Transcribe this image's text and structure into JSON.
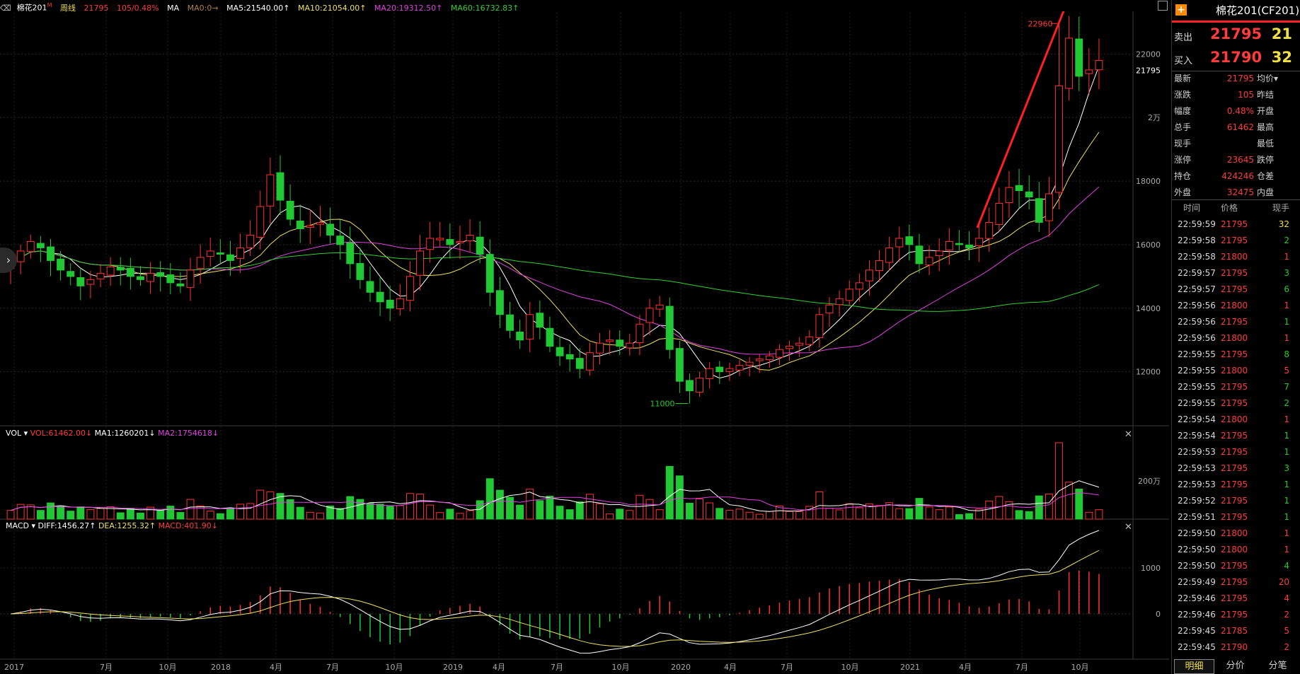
{
  "toolbar": {
    "symbol": "棉花201",
    "symbol_mark": "M",
    "period": "周线",
    "last": "21795",
    "change": "105/0.48%",
    "indicator": "MA",
    "ma0": "MA0:0→",
    "ma5": "MA5:21540.00↑",
    "ma10": "MA10:21054.00↑",
    "ma20": "MA20:19312.50↑",
    "ma60": "MA60:16732.83↑"
  },
  "vol_legend": {
    "name": "VOL",
    "vol": "VOL:61462.00↓",
    "ma1": "MA1:1260201↓",
    "ma2": "MA2:1754618↓"
  },
  "macd_legend": {
    "name": "MACD",
    "diff": "DIFF:1456.27↑",
    "dea": "DEA:1255.32↑",
    "macd": "MACD:401.90↓"
  },
  "colors": {
    "up": "#ff3232",
    "down": "#21c834",
    "ma5": "#ffffff",
    "ma10": "#f0e060",
    "ma20": "#e040e0",
    "ma60": "#30d030",
    "arrow": "#ff2020"
  },
  "chart_data": {
    "type": "candlestick",
    "x_ticks": [
      "2017",
      "7月",
      "10月",
      "2018",
      "4月",
      "7月",
      "10月",
      "2019",
      "4月",
      "7月",
      "10月",
      "2020",
      "4月",
      "7月",
      "10月",
      "2021",
      "4月",
      "7月",
      "10月"
    ],
    "y_ticks": [
      "22000",
      "2万",
      "18000",
      "16000",
      "14000",
      "12000"
    ],
    "y_range": [
      11000,
      22960
    ],
    "current_price_label": "21795",
    "high_label": "22960",
    "low_label": "11000",
    "vol_tick": "200万",
    "macd_ticks": [
      "1000",
      "0"
    ],
    "close_series": [
      15400,
      15800,
      16100,
      15900,
      15500,
      15200,
      15000,
      14700,
      14900,
      15100,
      15300,
      15200,
      15000,
      14900,
      15100,
      15000,
      14800,
      14700,
      15200,
      15600,
      15800,
      15700,
      15500,
      15900,
      16300,
      17200,
      18200,
      17400,
      16800,
      16500,
      16600,
      16700,
      16300,
      16000,
      15400,
      14900,
      14500,
      14200,
      14000,
      14300,
      15000,
      15800,
      16200,
      16200,
      16000,
      16100,
      16300,
      15700,
      14500,
      13800,
      13300,
      13000,
      13800,
      13400,
      12800,
      12500,
      12400,
      12100,
      12600,
      12900,
      13000,
      12800,
      12900,
      13500,
      14000,
      14100,
      12700,
      11700,
      11400,
      11800,
      12100,
      12000,
      12100,
      12200,
      12300,
      12400,
      12500,
      12700,
      12800,
      12900,
      13100,
      13800,
      14100,
      14300,
      14600,
      14800,
      15200,
      15500,
      15900,
      16200,
      16000,
      15400,
      15600,
      15800,
      16100,
      16000,
      15900,
      16200,
      16700,
      17300,
      17800,
      17700,
      17500,
      16700,
      17600,
      21000,
      22500,
      21300,
      21500,
      21795
    ]
  },
  "quote": {
    "title": "棉花201(CF201)",
    "sell_label": "卖出",
    "sell_price": "21795",
    "sell_qty": "21",
    "buy_label": "买入",
    "buy_price": "21790",
    "buy_qty": "32",
    "rows": [
      {
        "l": "最新",
        "v": "21795",
        "r": "均价▾"
      },
      {
        "l": "涨跌",
        "v": "105",
        "r": "昨结"
      },
      {
        "l": "幅度",
        "v": "0.48%",
        "r": "开盘"
      },
      {
        "l": "总手",
        "v": "61462",
        "r": "最高"
      },
      {
        "l": "现手",
        "v": "",
        "r": "最低"
      },
      {
        "l": "涨停",
        "v": "23645",
        "r": "跌停"
      },
      {
        "l": "持仓",
        "v": "424246",
        "r": "仓差"
      },
      {
        "l": "外盘",
        "v": "32475",
        "r": "内盘"
      }
    ]
  },
  "ticks_header": {
    "time": "时间",
    "price": "价格",
    "qty": "现手"
  },
  "ticks": [
    {
      "t": "22:59:59",
      "p": "21795",
      "q": "32",
      "qc": "yellow"
    },
    {
      "t": "22:59:58",
      "p": "21795",
      "q": "2",
      "qc": "green"
    },
    {
      "t": "22:59:58",
      "p": "21800",
      "q": "1",
      "qc": "red"
    },
    {
      "t": "22:59:57",
      "p": "21795",
      "q": "3",
      "qc": "green"
    },
    {
      "t": "22:59:57",
      "p": "21795",
      "q": "6",
      "qc": "green"
    },
    {
      "t": "22:59:56",
      "p": "21800",
      "q": "1",
      "qc": "red"
    },
    {
      "t": "22:59:56",
      "p": "21795",
      "q": "1",
      "qc": "green"
    },
    {
      "t": "22:59:56",
      "p": "21800",
      "q": "1",
      "qc": "red"
    },
    {
      "t": "22:59:55",
      "p": "21795",
      "q": "8",
      "qc": "green"
    },
    {
      "t": "22:59:55",
      "p": "21800",
      "q": "5",
      "qc": "red"
    },
    {
      "t": "22:59:55",
      "p": "21795",
      "q": "7",
      "qc": "green"
    },
    {
      "t": "22:59:55",
      "p": "21795",
      "q": "2",
      "qc": "green"
    },
    {
      "t": "22:59:54",
      "p": "21800",
      "q": "1",
      "qc": "red"
    },
    {
      "t": "22:59:54",
      "p": "21795",
      "q": "1",
      "qc": "green"
    },
    {
      "t": "22:59:53",
      "p": "21795",
      "q": "1",
      "qc": "green"
    },
    {
      "t": "22:59:53",
      "p": "21795",
      "q": "3",
      "qc": "green"
    },
    {
      "t": "22:59:53",
      "p": "21795",
      "q": "1",
      "qc": "green"
    },
    {
      "t": "22:59:52",
      "p": "21795",
      "q": "1",
      "qc": "green"
    },
    {
      "t": "22:59:51",
      "p": "21795",
      "q": "1",
      "qc": "green"
    },
    {
      "t": "22:59:50",
      "p": "21800",
      "q": "1",
      "qc": "red"
    },
    {
      "t": "22:59:50",
      "p": "21800",
      "q": "1",
      "qc": "red"
    },
    {
      "t": "22:59:50",
      "p": "21795",
      "q": "4",
      "qc": "green"
    },
    {
      "t": "22:59:49",
      "p": "21795",
      "q": "20",
      "qc": "red"
    },
    {
      "t": "22:59:46",
      "p": "21795",
      "q": "4",
      "qc": "red"
    },
    {
      "t": "22:59:46",
      "p": "21795",
      "q": "2",
      "qc": "red"
    },
    {
      "t": "22:59:45",
      "p": "21785",
      "q": "5",
      "qc": "red"
    },
    {
      "t": "22:59:45",
      "p": "21790",
      "q": "2",
      "qc": "red"
    }
  ],
  "tabs": [
    "明细",
    "分价",
    "分笔"
  ]
}
